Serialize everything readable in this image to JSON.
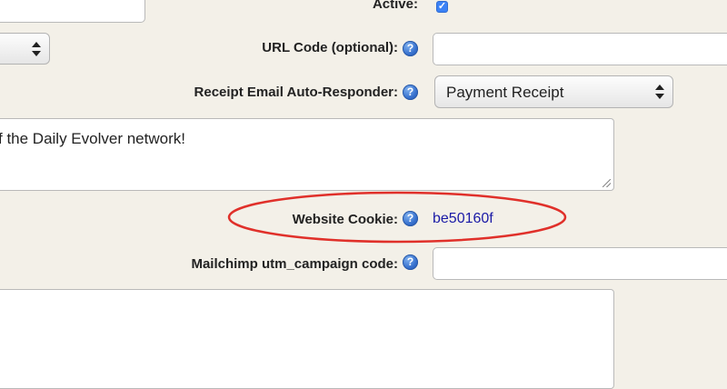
{
  "form": {
    "active": {
      "label": "Active:",
      "checked": true
    },
    "url_code": {
      "label": "URL Code (optional):",
      "help": "?",
      "value": ""
    },
    "receipt_responder": {
      "label": "Receipt Email Auto-Responder:",
      "help": "?",
      "selected": "Payment Receipt"
    },
    "description": {
      "value": "f the Daily Evolver network!"
    },
    "website_cookie": {
      "label": "Website Cookie:",
      "help": "?",
      "value": "be50160f"
    },
    "mailchimp": {
      "label": "Mailchimp utm_campaign code:",
      "help": "?",
      "value": ""
    },
    "left_select": {
      "selected": ""
    }
  },
  "colors": {
    "background": "#f3f0e8",
    "annotation_ellipse": "#e0302a",
    "cookie_value": "#1a1aa6",
    "help_icon": "#3a74d0",
    "checkbox": "#3b82f6"
  }
}
